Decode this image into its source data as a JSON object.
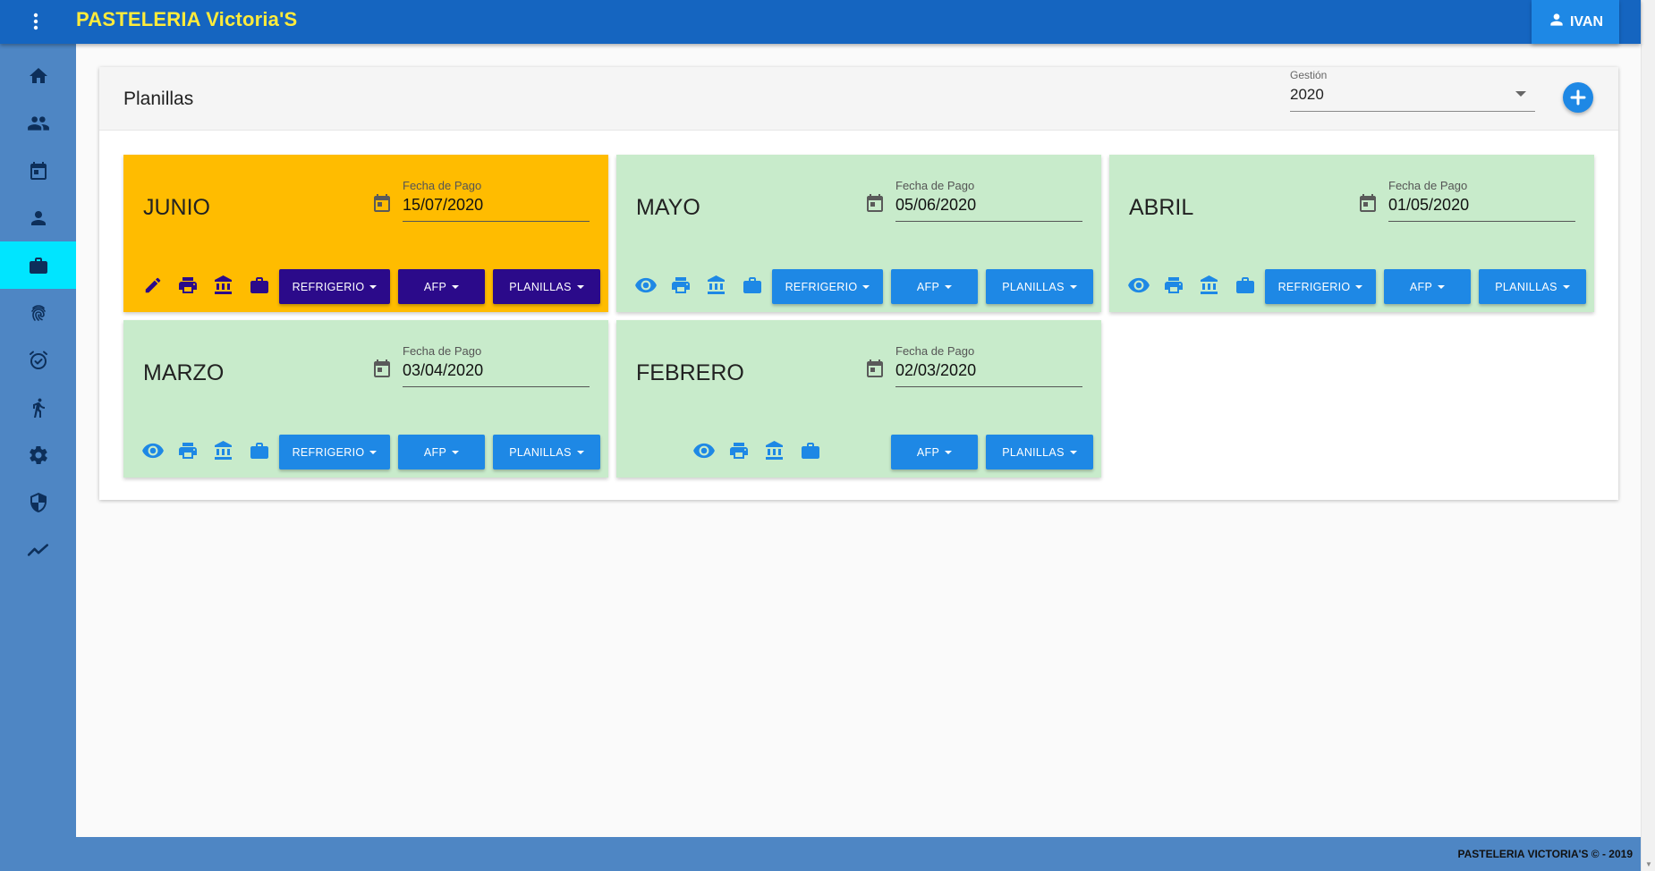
{
  "app": {
    "title": "PASTELERIA Victoria'S",
    "user": "IVAN"
  },
  "sidebar": {
    "items": [
      {
        "icon": "home-icon"
      },
      {
        "icon": "people-icon"
      },
      {
        "icon": "calendar-icon"
      },
      {
        "icon": "person-icon"
      },
      {
        "icon": "briefcase-icon",
        "active": true
      },
      {
        "icon": "fingerprint-icon"
      },
      {
        "icon": "alarm-check-icon"
      },
      {
        "icon": "run-icon"
      },
      {
        "icon": "gear-icon"
      },
      {
        "icon": "shield-icon"
      },
      {
        "icon": "trending-icon"
      }
    ]
  },
  "panel": {
    "title": "Planillas",
    "gestion_label": "Gestión",
    "gestion_value": "2020"
  },
  "colors": {
    "header": "#1565c0",
    "sidebar": "#4e86c4",
    "active_item": "#00e5ff",
    "brand_text": "#ffeb3b",
    "card_current": "#ffbc00",
    "card_closed": "#c8ebcb",
    "button_blue": "#1e88e5",
    "button_indigo": "#2b0a8a"
  },
  "fecha_label": "Fecha de Pago",
  "buttons": {
    "refrigerio": "REFRIGERIO",
    "afp": "AFP",
    "planillas": "PLANILLAS"
  },
  "cards": [
    {
      "month": "JUNIO",
      "fecha": "15/07/2020",
      "status": "current"
    },
    {
      "month": "MAYO",
      "fecha": "05/06/2020",
      "status": "closed"
    },
    {
      "month": "ABRIL",
      "fecha": "01/05/2020",
      "status": "closed"
    },
    {
      "month": "MARZO",
      "fecha": "03/04/2020",
      "status": "closed"
    },
    {
      "month": "FEBRERO",
      "fecha": "02/03/2020",
      "status": "closed"
    }
  ],
  "footer": "PASTELERIA VICTORIA'S © - 2019"
}
